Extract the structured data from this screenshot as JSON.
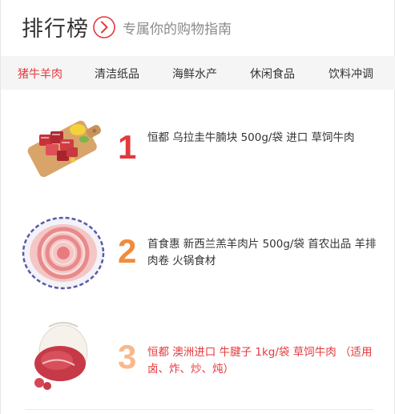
{
  "header": {
    "title": "排行榜",
    "subtitle": "专属你的购物指南",
    "arrow_icon": "chevron-right-circle-icon"
  },
  "tabs": [
    {
      "label": "猪牛羊肉",
      "active": true
    },
    {
      "label": "清洁纸品",
      "active": false
    },
    {
      "label": "海鲜水产",
      "active": false
    },
    {
      "label": "休闲食品",
      "active": false
    },
    {
      "label": "饮料冲调",
      "active": false
    }
  ],
  "items": [
    {
      "rank": "1",
      "name": "恒都 乌拉圭牛腩块 500g/袋 进口 草饲牛肉",
      "rank_color": "#e4393c",
      "image": "beef-brisket-cubes-on-board"
    },
    {
      "rank": "2",
      "name": "首食惠 新西兰羔羊肉片 500g/袋 首农出品 羊排肉卷 火锅食材",
      "rank_color": "#f08c3c",
      "image": "lamb-slices-plate"
    },
    {
      "rank": "3",
      "name": "恒都 澳洲进口 牛腱子 1kg/袋 草饲牛肉 （适用卤、炸、炒、炖）",
      "rank_color": "#f7b98c",
      "image": "beef-shank-with-bag"
    }
  ],
  "colors": {
    "accent": "#e4393c"
  }
}
